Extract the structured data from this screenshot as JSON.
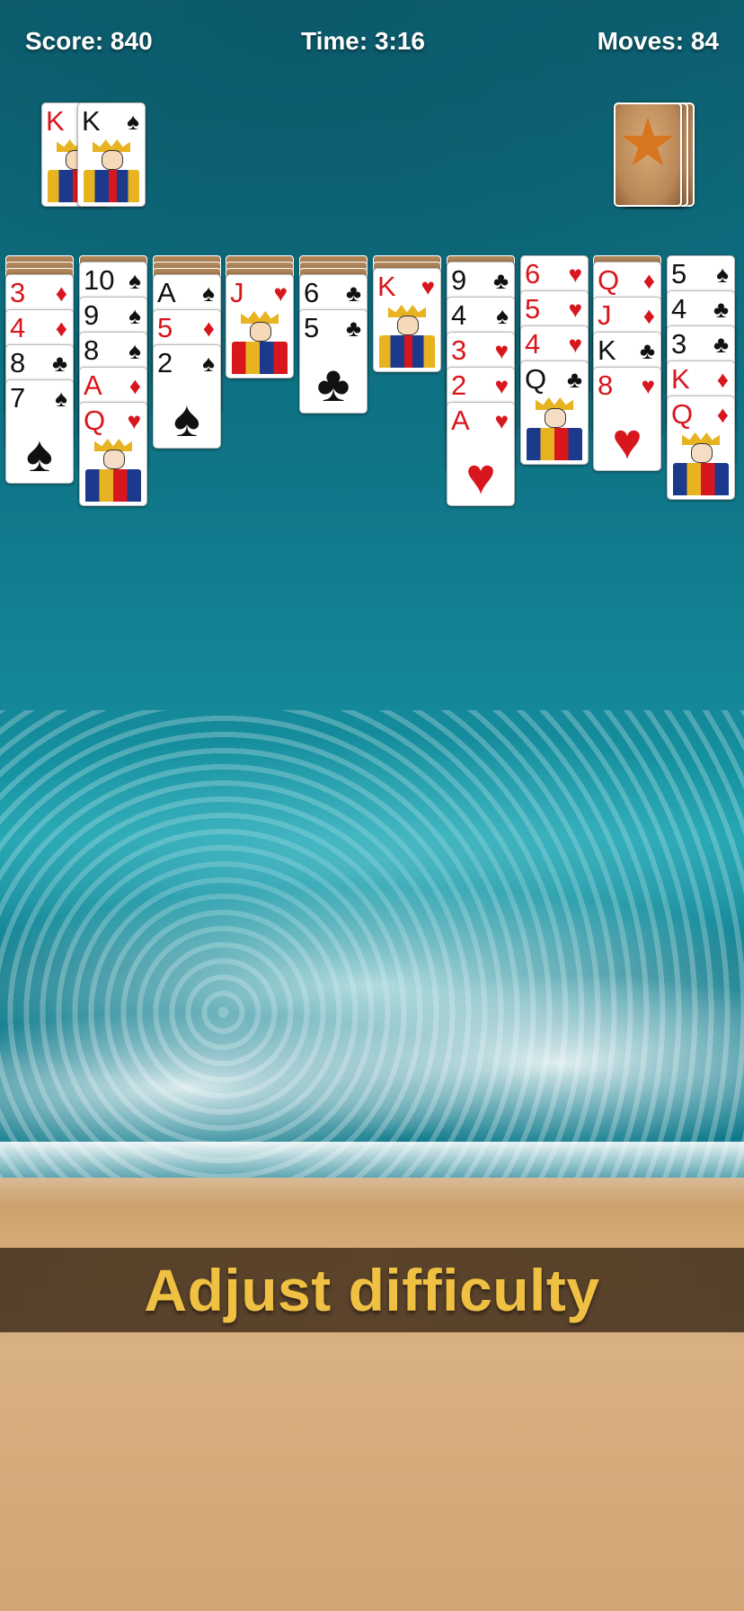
{
  "hud": {
    "score": "Score: 840",
    "time": "Time: 3:16",
    "moves": "Moves: 84"
  },
  "completed_foundations": [
    {
      "rank": "K",
      "suit": "♥",
      "color": "red"
    },
    {
      "rank": "K",
      "suit": "♠",
      "color": "black"
    }
  ],
  "stock": {
    "icon": "starfish-card-back-icon",
    "remaining_stacks": 3
  },
  "tableau": [
    {
      "hidden": 3,
      "cards": [
        {
          "rank": "3",
          "suit": "♦",
          "color": "red"
        },
        {
          "rank": "4",
          "suit": "♦",
          "color": "red"
        },
        {
          "rank": "8",
          "suit": "♣",
          "color": "black"
        },
        {
          "rank": "7",
          "suit": "♠",
          "color": "black"
        }
      ]
    },
    {
      "hidden": 1,
      "cards": [
        {
          "rank": "10",
          "suit": "♠",
          "color": "black"
        },
        {
          "rank": "9",
          "suit": "♠",
          "color": "black"
        },
        {
          "rank": "8",
          "suit": "♠",
          "color": "black"
        },
        {
          "rank": "A",
          "suit": "♦",
          "color": "red"
        },
        {
          "rank": "Q",
          "suit": "♥",
          "color": "red"
        }
      ]
    },
    {
      "hidden": 3,
      "cards": [
        {
          "rank": "A",
          "suit": "♠",
          "color": "black"
        },
        {
          "rank": "5",
          "suit": "♦",
          "color": "red"
        },
        {
          "rank": "2",
          "suit": "♠",
          "color": "black"
        }
      ]
    },
    {
      "hidden": 3,
      "cards": [
        {
          "rank": "J",
          "suit": "♥",
          "color": "red"
        }
      ]
    },
    {
      "hidden": 3,
      "cards": [
        {
          "rank": "6",
          "suit": "♣",
          "color": "black"
        },
        {
          "rank": "5",
          "suit": "♣",
          "color": "black"
        }
      ]
    },
    {
      "hidden": 2,
      "cards": [
        {
          "rank": "K",
          "suit": "♥",
          "color": "red"
        }
      ]
    },
    {
      "hidden": 1,
      "cards": [
        {
          "rank": "9",
          "suit": "♣",
          "color": "black"
        },
        {
          "rank": "4",
          "suit": "♠",
          "color": "black"
        },
        {
          "rank": "3",
          "suit": "♥",
          "color": "red"
        },
        {
          "rank": "2",
          "suit": "♥",
          "color": "red"
        },
        {
          "rank": "A",
          "suit": "♥",
          "color": "red"
        }
      ]
    },
    {
      "hidden": 0,
      "cards": [
        {
          "rank": "6",
          "suit": "♥",
          "color": "red"
        },
        {
          "rank": "5",
          "suit": "♥",
          "color": "red"
        },
        {
          "rank": "4",
          "suit": "♥",
          "color": "red"
        },
        {
          "rank": "Q",
          "suit": "♣",
          "color": "black"
        }
      ]
    },
    {
      "hidden": 1,
      "cards": [
        {
          "rank": "Q",
          "suit": "♦",
          "color": "red"
        },
        {
          "rank": "J",
          "suit": "♦",
          "color": "red"
        },
        {
          "rank": "K",
          "suit": "♣",
          "color": "black"
        },
        {
          "rank": "8",
          "suit": "♥",
          "color": "red"
        }
      ]
    },
    {
      "hidden": 0,
      "cards": [
        {
          "rank": "5",
          "suit": "♠",
          "color": "black"
        },
        {
          "rank": "4",
          "suit": "♣",
          "color": "black"
        },
        {
          "rank": "3",
          "suit": "♣",
          "color": "black"
        },
        {
          "rank": "K",
          "suit": "♦",
          "color": "red"
        },
        {
          "rank": "Q",
          "suit": "♦",
          "color": "red"
        }
      ]
    }
  ],
  "banner": {
    "text": "Adjust difficulty"
  },
  "colors": {
    "red_suit": "#d8161d",
    "black_suit": "#111111",
    "banner_text": "#f0c043"
  }
}
